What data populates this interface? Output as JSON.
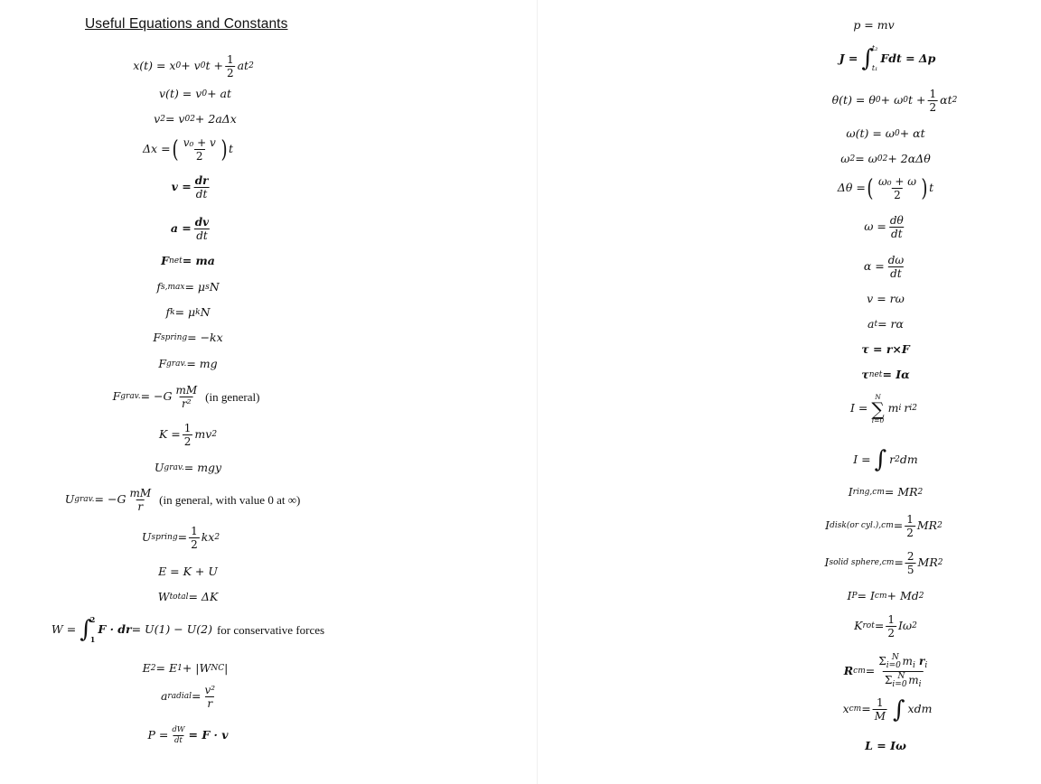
{
  "document": {
    "title": "Useful Equations and Constants"
  },
  "left_column": {
    "x_t": {
      "lhs": "x(t) = x",
      "sub0": "0",
      "mid": " + v",
      "sub1": "0",
      "mid2": "t + ",
      "num": "1",
      "den": "2",
      "tail": "at",
      "sup": "2"
    },
    "v_t": {
      "lhs": "v(t) = v",
      "sub0": "0",
      "tail": " + at"
    },
    "v_sq": {
      "lhs": "v",
      "sup": "2",
      "mid": " = v",
      "sub0": "0",
      "sup2": "2",
      "tail": " + 2aΔx"
    },
    "delta_x": {
      "lhs": "Δx = ",
      "num": "v₀ + v",
      "den": "2",
      "tail": "t"
    },
    "velocity": {
      "lhs": "v = ",
      "num": "dr",
      "den": "dt"
    },
    "acceleration": {
      "lhs": "a = ",
      "num": "dv",
      "den": "dt"
    },
    "f_net": {
      "lhs": "F",
      "sub": "net",
      "rhs": " = ma"
    },
    "f_smax": {
      "lhs": "f",
      "sub": "s,max",
      "rhs": " = μ",
      "sub2": "s",
      "tail": "N"
    },
    "f_k": {
      "lhs": "f",
      "sub": "k",
      "rhs": " = μ",
      "sub2": "k",
      "tail": "N"
    },
    "f_spring": {
      "lhs": "F",
      "sub": "spring",
      "rhs": " = −kx"
    },
    "f_grav": {
      "lhs": "F",
      "sub": "grav.",
      "rhs": " = mg"
    },
    "f_grav_general": {
      "lhs": "F",
      "sub": "grav.",
      "rhs": " = −G",
      "num": "mM",
      "den": "r²",
      "note": "(in general)"
    },
    "kinetic": {
      "lhs": "K = ",
      "num": "1",
      "den": "2",
      "tail": "mv",
      "sup": "2"
    },
    "u_grav": {
      "lhs": "U",
      "sub": "grav.",
      "rhs": " = mgy"
    },
    "u_grav_general": {
      "lhs": "U",
      "sub": "grav.",
      "rhs": " = −G",
      "num": "mM",
      "den": "r",
      "note": "(in general, with value 0 at ∞)"
    },
    "u_spring": {
      "lhs": "U",
      "sub": "spring",
      "rhs": " = ",
      "num": "1",
      "den": "2",
      "tail": "kx",
      "sup": "2"
    },
    "energy": {
      "text": "E = K + U"
    },
    "work_total": {
      "lhs": "W",
      "sub": "total",
      "rhs": " = ΔK"
    },
    "work_integral": {
      "lhs": "W = ",
      "upper": "2",
      "lower": "1",
      "body": "F · dr",
      "rhs": " = U(1) − U(2)",
      "note": "for conservative forces"
    },
    "energy_nc": {
      "lhs": "E",
      "sub": "2",
      "rhs": " = E",
      "sub2": "1",
      "tail": " + |W",
      "sub3": "NC",
      "end": "|"
    },
    "a_radial": {
      "lhs": "a",
      "sub": "radial",
      "rhs": " = ",
      "num": "v²",
      "den": "r"
    },
    "power": {
      "lhs": "P = ",
      "num": "dW",
      "den": "dt",
      "rhs": " = F · v"
    }
  },
  "right_column": {
    "momentum": {
      "text": "p = mv"
    },
    "impulse": {
      "lhs": "J = ",
      "upper": "t₂",
      "lower": "t₁",
      "body": "Fdt = Δp"
    },
    "theta_t": {
      "lhs": "θ(t) = θ",
      "sub0": "0",
      "mid": " + ω",
      "sub1": "0",
      "mid2": "t + ",
      "num": "1",
      "den": "2",
      "tail": "αt",
      "sup": "2"
    },
    "omega_t": {
      "lhs": "ω(t) = ω",
      "sub0": "0",
      "tail": " + αt"
    },
    "omega_sq": {
      "lhs": "ω",
      "sup": "2",
      "mid": " = ω",
      "sub0": "0",
      "sup2": "2",
      "tail": " + 2αΔθ"
    },
    "delta_theta": {
      "lhs": "Δθ = ",
      "num": "ω₀ + ω",
      "den": "2",
      "tail": "t"
    },
    "omega_def": {
      "lhs": "ω = ",
      "num": "dθ",
      "den": "dt"
    },
    "alpha_def": {
      "lhs": "α = ",
      "num": "dω",
      "den": "dt"
    },
    "v_rw": {
      "text": "v = rω"
    },
    "a_t": {
      "lhs": "a",
      "sub": "t",
      "rhs": " = rα"
    },
    "torque": {
      "text": "τ = r×F"
    },
    "torque_net": {
      "lhs": "τ",
      "sub": "net",
      "rhs": " = Iα"
    },
    "inertia_sum": {
      "lhs": "I = ",
      "upper": "N",
      "lower": "i=0",
      "body": "m",
      "sub": "i",
      "body2": "r",
      "sub2": "i",
      "sup": "2"
    },
    "inertia_int": {
      "lhs": "I = ",
      "body": "r",
      "sup": "2",
      "tail": "dm"
    },
    "i_ring": {
      "lhs": "I",
      "sub": "ring,cm",
      "rhs": " = MR",
      "sup": "2"
    },
    "i_disk": {
      "lhs": "I",
      "sub": "disk(or cyl.),cm",
      "rhs": " = ",
      "num": "1",
      "den": "2",
      "tail": "MR",
      "sup": "2"
    },
    "i_sphere": {
      "lhs": "I",
      "sub": "solid sphere,cm",
      "rhs": " = ",
      "num": "2",
      "den": "5",
      "tail": "MR",
      "sup": "2"
    },
    "parallel_axis": {
      "lhs": "I",
      "sub": "P",
      "rhs": " = I",
      "sub2": "cm",
      "tail": " + Md",
      "sup": "2"
    },
    "k_rot": {
      "lhs": "K",
      "sub": "rot",
      "rhs": " = ",
      "num": "1",
      "den": "2",
      "tail": "Iω",
      "sup": "2"
    },
    "r_cm": {
      "lhs": "R",
      "sub": "cm",
      "rhs": " = ",
      "num": "Σ",
      "num_sub": "i=0",
      "num_sup": "N",
      "num_body": " m",
      "num_i": "i",
      "num_r": " r",
      "num_ri": "i",
      "den": "Σ",
      "den_sub": "i=0",
      "den_sup": "N",
      "den_body": " m",
      "den_i": "i"
    },
    "x_cm": {
      "lhs": "x",
      "sub": "cm",
      "rhs": " = ",
      "num": "1",
      "den": "M",
      "tail": "xdm"
    },
    "angular_momentum": {
      "text": "L = Iω"
    }
  }
}
